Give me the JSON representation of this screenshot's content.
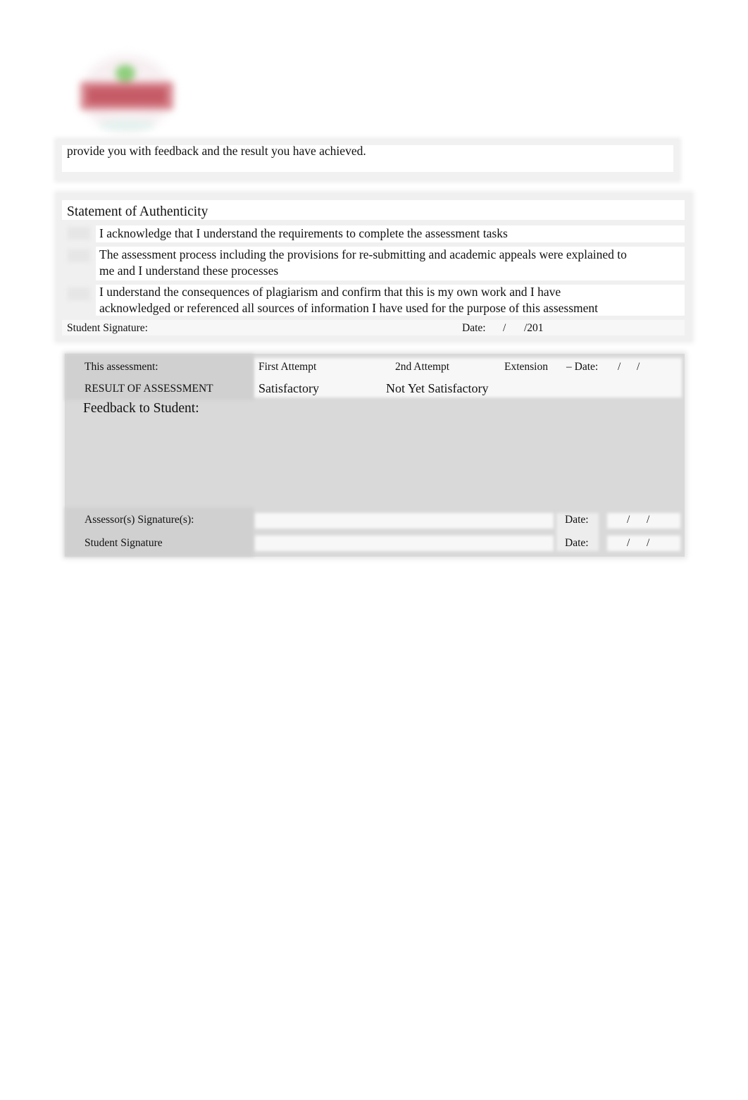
{
  "logo": {
    "icon": "institution-logo-icon",
    "colors": {
      "leaf": "#8fcf7d",
      "banner": "#c55b66"
    }
  },
  "intro_box": {
    "text": "provide you with feedback and the result you have achieved."
  },
  "authenticity": {
    "title": "Statement of Authenticity",
    "statements": [
      {
        "line1": "I acknowledge that I understand the requirements to complete the assessment tasks",
        "line2": ""
      },
      {
        "line1": "The assessment process including the provisions for re-submitting and academic appeals were explained to",
        "line2": "me and I understand these processes"
      },
      {
        "line1": "I understand the consequences of plagiarism and confirm that this is my own work and I have",
        "line2": "acknowledged or referenced all sources of information I have used for the purpose of this assessment"
      }
    ],
    "student_signature_label": "Student Signature:",
    "date_label": "Date:",
    "date_sep": "/",
    "date_year": "/201"
  },
  "assessment": {
    "this_assessment_label": "This assessment:",
    "first_attempt": "First Attempt",
    "second_attempt": "2nd Attempt",
    "extension": "Extension",
    "extension_date_label": "– Date:",
    "date_sep": "/",
    "result_label": "RESULT OF ASSESSMENT",
    "satisfactory": "Satisfactory",
    "not_yet_satisfactory": "Not Yet Satisfactory",
    "feedback_label": "Feedback to Student:",
    "assessor_signature_label": "Assessor(s) Signature(s):",
    "student_signature_label": "Student Signature",
    "date_label": "Date:"
  }
}
